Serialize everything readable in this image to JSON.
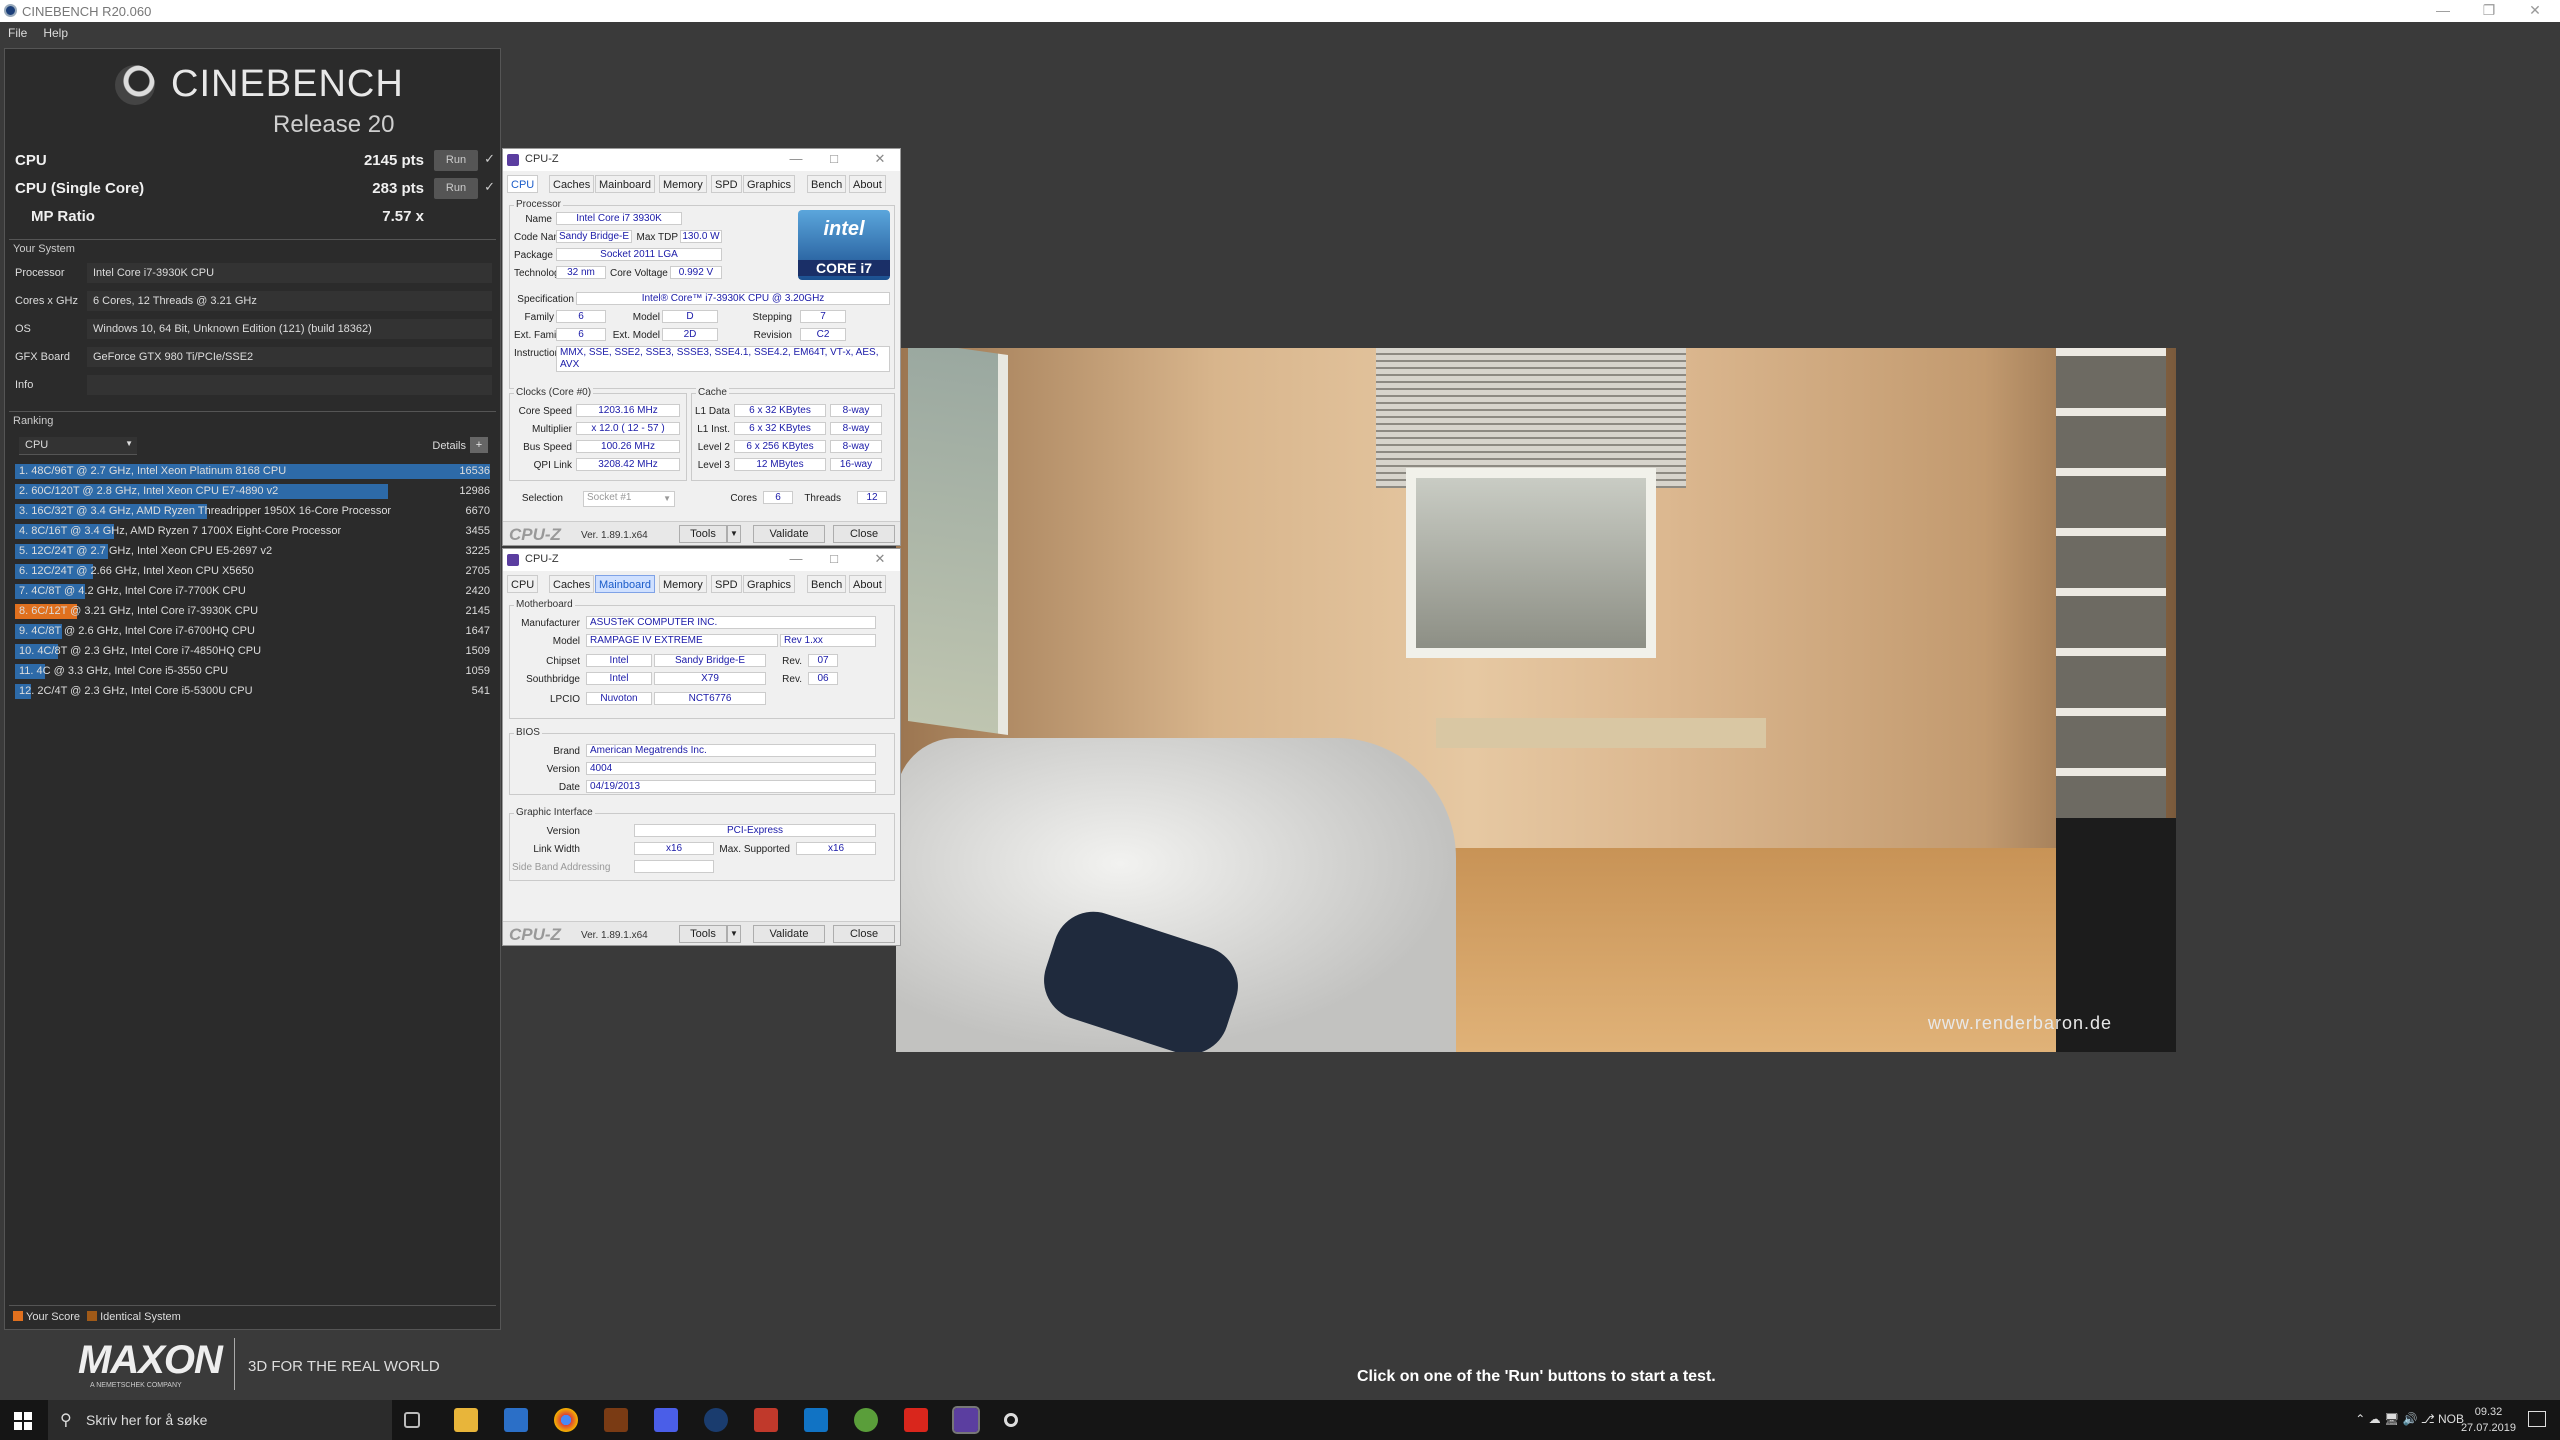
{
  "window": {
    "title": "CINEBENCH R20.060"
  },
  "menu": [
    "File",
    "Help"
  ],
  "logo": {
    "name": "CINEBENCH",
    "release": "Release 20"
  },
  "scores": [
    {
      "label": "CPU",
      "value": "2145 pts",
      "run": "Run",
      "check": "✓"
    },
    {
      "label": "CPU (Single Core)",
      "value": "283 pts",
      "run": "Run",
      "check": "✓"
    },
    {
      "label": "MP Ratio",
      "value": "7.57 x"
    }
  ],
  "your_system": {
    "title": "Your System",
    "rows": [
      {
        "key": "Processor",
        "value": "Intel Core i7-3930K CPU"
      },
      {
        "key": "Cores x GHz",
        "value": "6 Cores, 12 Threads @ 3.21 GHz"
      },
      {
        "key": "OS",
        "value": "Windows 10, 64 Bit, Unknown Edition (121) (build 18362)"
      },
      {
        "key": "GFX Board",
        "value": "GeForce GTX 980 Ti/PCIe/SSE2"
      },
      {
        "key": "Info",
        "value": ""
      }
    ]
  },
  "ranking": {
    "title": "Ranking",
    "select": "CPU",
    "details": "Details",
    "details_btn": "+",
    "max": 16536,
    "items": [
      {
        "label": "1. 48C/96T @ 2.7 GHz, Intel Xeon Platinum 8168 CPU",
        "score": 16536,
        "mine": false
      },
      {
        "label": "2. 60C/120T @ 2.8 GHz, Intel Xeon CPU E7-4890 v2",
        "score": 12986,
        "mine": false
      },
      {
        "label": "3. 16C/32T @ 3.4 GHz, AMD Ryzen Threadripper 1950X 16-Core Processor",
        "score": 6670,
        "mine": false
      },
      {
        "label": "4. 8C/16T @ 3.4 GHz, AMD Ryzen 7 1700X Eight-Core Processor",
        "score": 3455,
        "mine": false
      },
      {
        "label": "5. 12C/24T @ 2.7 GHz, Intel Xeon CPU E5-2697 v2",
        "score": 3225,
        "mine": false
      },
      {
        "label": "6. 12C/24T @ 2.66 GHz, Intel Xeon CPU X5650",
        "score": 2705,
        "mine": false
      },
      {
        "label": "7. 4C/8T @ 4.2 GHz, Intel Core i7-7700K CPU",
        "score": 2420,
        "mine": false
      },
      {
        "label": "8. 6C/12T @ 3.21 GHz, Intel Core i7-3930K CPU",
        "score": 2145,
        "mine": true
      },
      {
        "label": "9. 4C/8T @ 2.6 GHz, Intel Core i7-6700HQ CPU",
        "score": 1647,
        "mine": false
      },
      {
        "label": "10. 4C/8T @ 2.3 GHz, Intel Core i7-4850HQ CPU",
        "score": 1509,
        "mine": false
      },
      {
        "label": "11. 4C @ 3.3 GHz, Intel Core i5-3550 CPU",
        "score": 1059,
        "mine": false
      },
      {
        "label": "12. 2C/4T @ 2.3 GHz, Intel Core i5-5300U CPU",
        "score": 541,
        "mine": false
      }
    ],
    "legend": {
      "your_score": "Your Score",
      "identical": "Identical System"
    }
  },
  "maxon": {
    "brand": "MAXON",
    "sub": "A NEMETSCHEK COMPANY",
    "tagline": "3D FOR THE REAL WORLD"
  },
  "hint": "Click on one of the 'Run' buttons to start a test.",
  "render": {
    "watermark": "www.renderbaron.de"
  },
  "cpuz1": {
    "title": "CPU-Z",
    "tabs": [
      "CPU",
      "Caches",
      "Mainboard",
      "Memory",
      "SPD",
      "Graphics",
      "Bench",
      "About"
    ],
    "processor": {
      "group": "Processor",
      "name_label": "Name",
      "name": "Intel Core i7 3930K",
      "codename_label": "Code Name",
      "codename": "Sandy Bridge-E",
      "maxtdp_label": "Max TDP",
      "maxtdp": "130.0 W",
      "package_label": "Package",
      "package": "Socket 2011 LGA",
      "tech_label": "Technology",
      "tech": "32 nm",
      "voltage_label": "Core Voltage",
      "voltage": "0.992 V",
      "spec_label": "Specification",
      "spec": "Intel® Core™ i7-3930K CPU @ 3.20GHz",
      "family_label": "Family",
      "family": "6",
      "model_label": "Model",
      "model": "D",
      "stepping_label": "Stepping",
      "stepping": "7",
      "extfamily_label": "Ext. Family",
      "extfamily": "6",
      "extmodel_label": "Ext. Model",
      "extmodel": "2D",
      "revision_label": "Revision",
      "revision": "C2",
      "instr_label": "Instructions",
      "instr": "MMX, SSE, SSE2, SSE3, SSSE3, SSE4.1, SSE4.2, EM64T, VT-x, AES, AVX",
      "intel1": "intel",
      "intel2": "CORE i7"
    },
    "clocks": {
      "group": "Clocks (Core #0)",
      "core_speed_label": "Core Speed",
      "core_speed": "1203.16 MHz",
      "mult_label": "Multiplier",
      "mult": "x 12.0 ( 12 - 57 )",
      "bus_label": "Bus Speed",
      "bus": "100.26 MHz",
      "qpi_label": "QPI Link",
      "qpi": "3208.42 MHz"
    },
    "cache": {
      "group": "Cache",
      "l1d_label": "L1 Data",
      "l1d": "6 x 32 KBytes",
      "l1d_way": "8-way",
      "l1i_label": "L1 Inst.",
      "l1i": "6 x 32 KBytes",
      "l1i_way": "8-way",
      "l2_label": "Level 2",
      "l2": "6 x 256 KBytes",
      "l2_way": "8-way",
      "l3_label": "Level 3",
      "l3": "12 MBytes",
      "l3_way": "16-way"
    },
    "selection_label": "Selection",
    "selection": "Socket #1",
    "cores_label": "Cores",
    "cores": "6",
    "threads_label": "Threads",
    "threads": "12",
    "footer": {
      "logo": "CPU-Z",
      "ver": "Ver. 1.89.1.x64",
      "tools": "Tools",
      "validate": "Validate",
      "close": "Close"
    }
  },
  "cpuz2": {
    "title": "CPU-Z",
    "tabs": [
      "CPU",
      "Caches",
      "Mainboard",
      "Memory",
      "SPD",
      "Graphics",
      "Bench",
      "About"
    ],
    "mb": {
      "group": "Motherboard",
      "manuf_label": "Manufacturer",
      "manuf": "ASUSTeK COMPUTER INC.",
      "model_label": "Model",
      "model": "RAMPAGE IV EXTREME",
      "rev": "Rev 1.xx",
      "chipset_label": "Chipset",
      "chipset_v": "Intel",
      "chipset_n": "Sandy Bridge-E",
      "chipset_rev_label": "Rev.",
      "chipset_rev": "07",
      "sb_label": "Southbridge",
      "sb_v": "Intel",
      "sb_n": "X79",
      "sb_rev_label": "Rev.",
      "sb_rev": "06",
      "lpcio_label": "LPCIO",
      "lpcio_v": "Nuvoton",
      "lpcio_n": "NCT6776"
    },
    "bios": {
      "group": "BIOS",
      "brand_label": "Brand",
      "brand": "American Megatrends Inc.",
      "version_label": "Version",
      "version": "4004",
      "date_label": "Date",
      "date": "04/19/2013"
    },
    "gi": {
      "group": "Graphic Interface",
      "version_label": "Version",
      "version": "PCI-Express",
      "lw_label": "Link Width",
      "lw": "x16",
      "ms_label": "Max. Supported",
      "ms": "x16",
      "sba_label": "Side Band Addressing"
    },
    "footer": {
      "logo": "CPU-Z",
      "ver": "Ver. 1.89.1.x64",
      "tools": "Tools",
      "validate": "Validate",
      "close": "Close"
    }
  },
  "taskbar": {
    "search": "Skriv her for å søke",
    "lang": "NOB",
    "time": "09.32",
    "date": "27.07.2019"
  }
}
